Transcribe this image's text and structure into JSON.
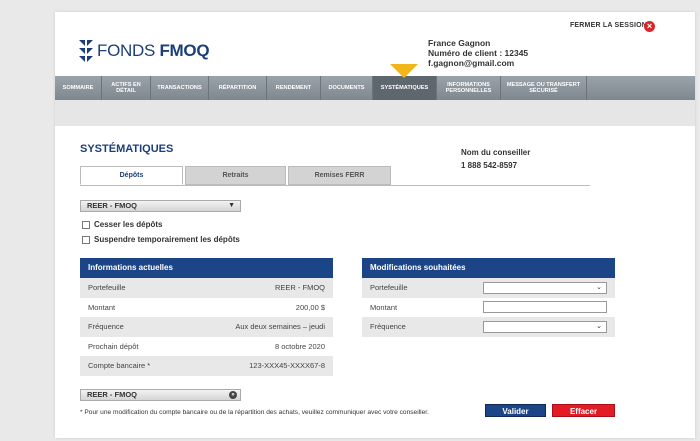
{
  "brand": {
    "logo_light": "FONDS",
    "logo_bold": "FMOQ",
    "color": "#1c3f7a"
  },
  "header": {
    "logout_label": "FERMER LA SESSION",
    "user_name": "France Gagnon",
    "client_line": "Numéro de client : 12345",
    "email": "f.gagnon@gmail.com"
  },
  "nav": {
    "items": [
      {
        "label": "SOMMAIRE"
      },
      {
        "label": "ACTIFS EN DÉTAIL"
      },
      {
        "label": "TRANSACTIONS"
      },
      {
        "label": "RÉPARTITION"
      },
      {
        "label": "RENDEMENT"
      },
      {
        "label": "DOCUMENTS"
      },
      {
        "label": "SYSTÉMATIQUES"
      },
      {
        "label": "INFORMATIONS PERSONNELLES"
      },
      {
        "label": "MESSAGE OU TRANSFERT SÉCURISÉ"
      }
    ],
    "active": "SYSTÉMATIQUES",
    "accent": "#f3b61a"
  },
  "page_title": "SYSTÉMATIQUES",
  "advisor": {
    "name": "Nom du conseiller",
    "phone": "1 888 542-8597"
  },
  "tabs": [
    {
      "label": "Dépôts",
      "active": true
    },
    {
      "label": "Retraits",
      "active": false
    },
    {
      "label": "Remises FERR",
      "active": false
    }
  ],
  "account_select": {
    "value": "REER - FMOQ"
  },
  "options": {
    "stop": "Cesser les dépôts",
    "suspend": "Suspendre temporairement les dépôts"
  },
  "current": {
    "title": "Informations actuelles",
    "rows": [
      {
        "label": "Portefeuille",
        "value": "REER - FMOQ"
      },
      {
        "label": "Montant",
        "value": "200,00 $"
      },
      {
        "label": "Fréquence",
        "value": "Aux deux semaines – jeudi"
      },
      {
        "label": "Prochain dépôt",
        "value": "8 octobre 2020"
      },
      {
        "label": "Compte bancaire *",
        "value": "123-XXX45-XXXX67-8"
      }
    ]
  },
  "changes": {
    "title": "Modifications souhaitées",
    "rows": [
      {
        "label": "Portefeuille"
      },
      {
        "label": "Montant"
      },
      {
        "label": "Fréquence"
      }
    ]
  },
  "bottom_select": {
    "value": "REER - FMOQ"
  },
  "footnote": "* Pour une modification du compte bancaire ou de la répartition des achats, veuillez communiquer avec votre conseiller.",
  "buttons": {
    "submit": "Valider",
    "clear": "Effacer",
    "submit_color": "#1c4587",
    "clear_color": "#e21b25"
  }
}
